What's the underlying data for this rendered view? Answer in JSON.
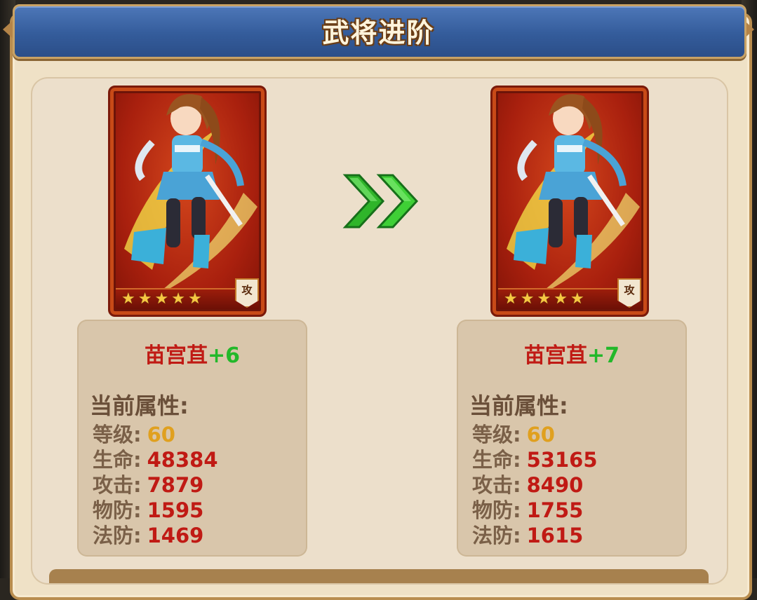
{
  "window": {
    "title": "武将进阶"
  },
  "colors": {
    "title_bar": "#345c9b",
    "hero_name": "#c01a14",
    "plus_level": "#23b82a",
    "value_red": "#c01a14",
    "value_gold": "#e0a01f",
    "label_brown": "#7a6048",
    "arrow_green": "#2fb52a"
  },
  "arrow": {
    "icon": "double-chevron-right-icon"
  },
  "before": {
    "card": {
      "stars": [
        "★",
        "★",
        "★",
        "★",
        "★"
      ],
      "star_count": 5,
      "type_badge": "攻"
    },
    "name": "苗宫苴",
    "plus": "+6",
    "heading": "当前属性:",
    "stats": [
      {
        "label": "等级:",
        "value": "60"
      },
      {
        "label": "生命:",
        "value": "48384"
      },
      {
        "label": "攻击:",
        "value": "7879"
      },
      {
        "label": "物防:",
        "value": "1595"
      },
      {
        "label": "法防:",
        "value": "1469"
      }
    ]
  },
  "after": {
    "card": {
      "stars": [
        "★",
        "★",
        "★",
        "★",
        "★"
      ],
      "star_count": 5,
      "type_badge": "攻"
    },
    "name": "苗宫苴",
    "plus": "+7",
    "heading": "当前属性:",
    "stats": [
      {
        "label": "等级:",
        "value": "60"
      },
      {
        "label": "生命:",
        "value": "53165"
      },
      {
        "label": "攻击:",
        "value": "8490"
      },
      {
        "label": "物防:",
        "value": "1755"
      },
      {
        "label": "法防:",
        "value": "1615"
      }
    ]
  }
}
